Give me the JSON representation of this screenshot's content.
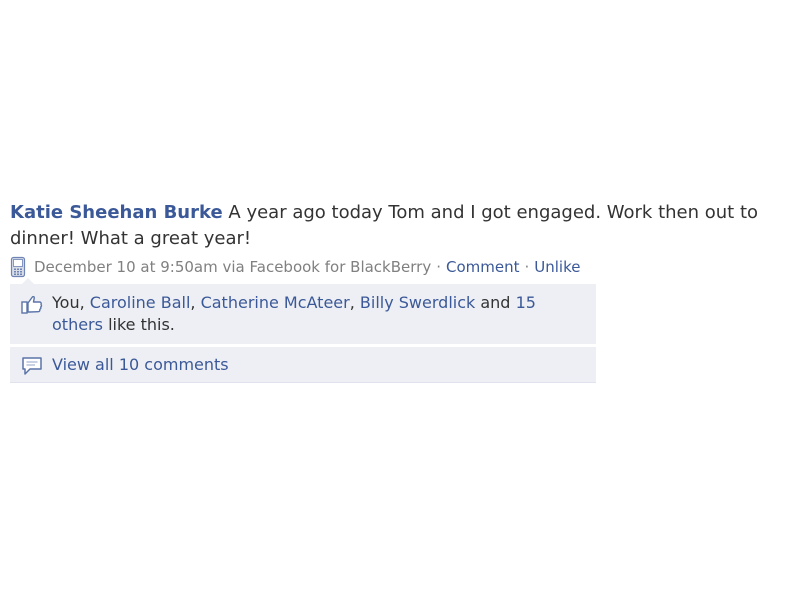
{
  "story": {
    "actor": "Katie Sheehan Burke",
    "message": "A year ago today Tom and I got engaged. Work then out to dinner! What a great year!",
    "timestamp": "December 10 at 9:50am via Facebook for BlackBerry",
    "separator": "·",
    "comment_link": "Comment",
    "unlike_link": "Unlike",
    "source_icon": "mobile-phone-icon"
  },
  "likes": {
    "icon": "thumbs-up-icon",
    "prefix": "You,",
    "people": [
      "Caroline Ball",
      "Catherine McAteer",
      "Billy Swerdlick"
    ],
    "comma": ",",
    "and": "and",
    "others_link": "15 others",
    "suffix": "like this."
  },
  "comments": {
    "icon": "comment-bubble-icon",
    "view_all_label": "View all 10 comments"
  },
  "colors": {
    "link": "#3b5998",
    "ufi_background": "#edeff4",
    "meta_text": "#808080",
    "body_text": "#333333"
  }
}
